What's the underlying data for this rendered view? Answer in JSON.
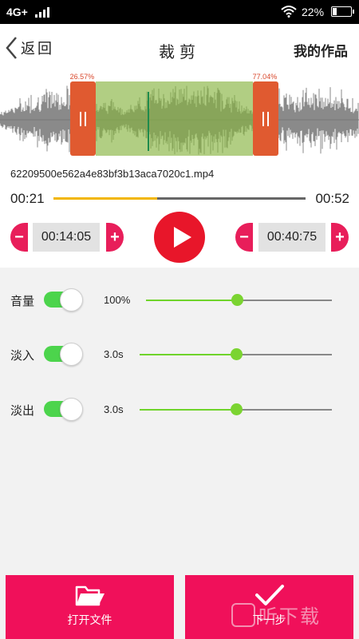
{
  "status_bar": {
    "network": "4G+",
    "battery": "22%"
  },
  "nav": {
    "back_label": "返回",
    "title": "裁剪",
    "works_label": "我的作品"
  },
  "waveform": {
    "start_percent_label": "26.57%",
    "end_percent_label": "77.04%",
    "start_fraction": 0.2657,
    "end_fraction": 0.7704,
    "playhead_fraction": 0.41
  },
  "file": {
    "name": "62209500e562a4e83bf3b13aca7020c1.mp4"
  },
  "playback": {
    "current_time": "00:21",
    "total_time": "00:52",
    "progress_fraction": 0.41
  },
  "trim": {
    "start_time": "00:14:05",
    "end_time": "00:40:75",
    "minus_symbol": "−",
    "plus_symbol": "+"
  },
  "settings": [
    {
      "label": "音量",
      "enabled": true,
      "value": "100%",
      "level": 0.49
    },
    {
      "label": "淡入",
      "enabled": true,
      "value": "3.0s",
      "level": 0.5
    },
    {
      "label": "淡出",
      "enabled": true,
      "value": "3.0s",
      "level": 0.5
    }
  ],
  "bottom": {
    "open_file_label": "打开文件",
    "next_label": "下一步"
  },
  "watermark": {
    "text": "听下载"
  },
  "colors": {
    "accent": "#f0105a",
    "play": "#e8162a",
    "toggle_on": "#4cd44c",
    "slider": "#7bd431",
    "handle": "#e05a30",
    "selection": "#87b440",
    "progress": "#f2b600"
  },
  "icons": {
    "back": "chevron-left-icon",
    "play": "play-icon",
    "open_file": "folder-icon",
    "next": "checkmark-icon",
    "wifi": "wifi-icon",
    "signal": "signal-icon",
    "battery": "battery-icon"
  }
}
